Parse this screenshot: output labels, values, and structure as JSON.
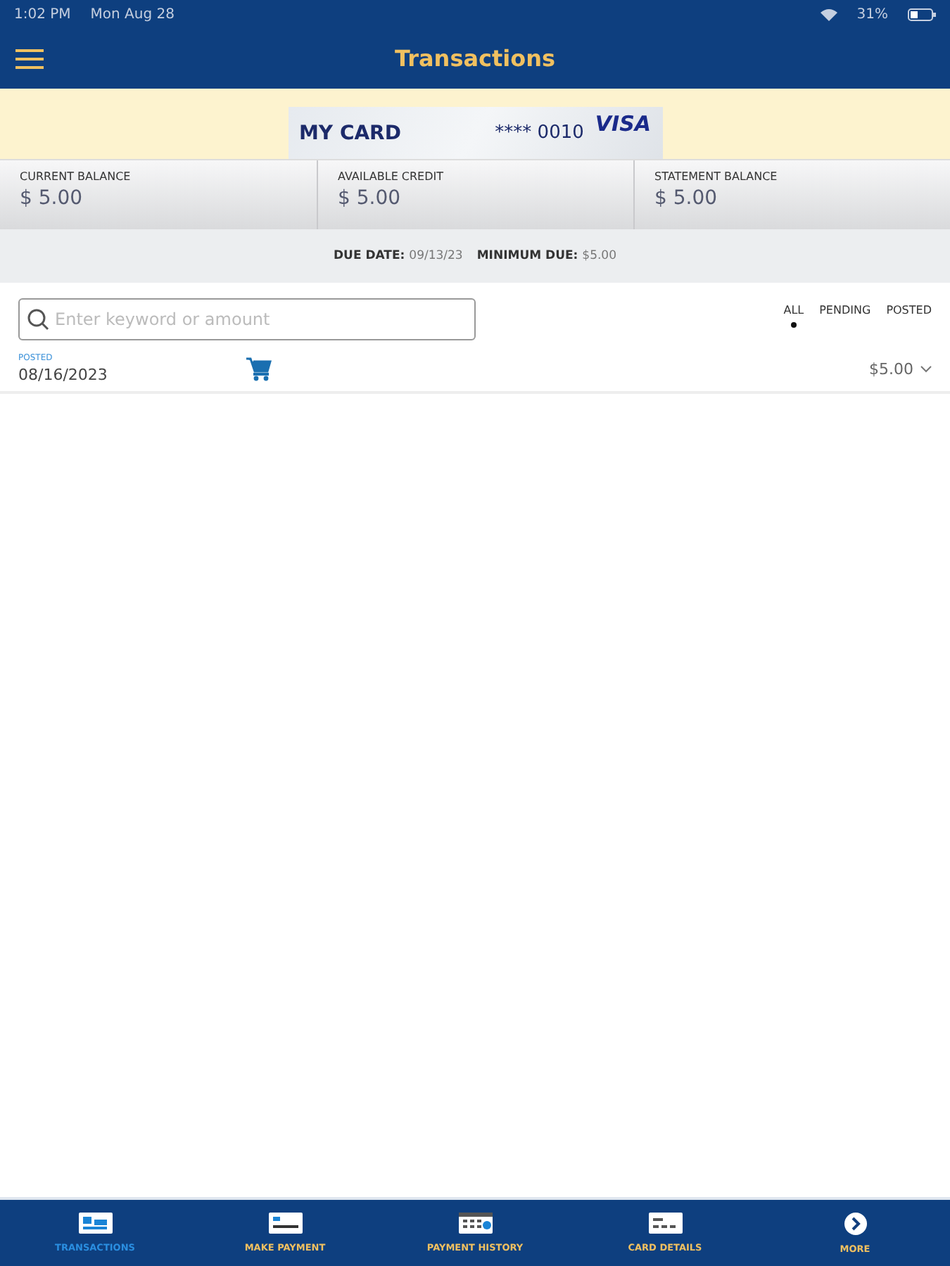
{
  "status_bar": {
    "time": "1:02 PM",
    "date": "Mon Aug 28",
    "battery": "31%"
  },
  "header": {
    "title": "Transactions"
  },
  "card": {
    "name": "MY CARD",
    "number": "**** 0010",
    "brand": "VISA"
  },
  "balances": [
    {
      "label": "CURRENT BALANCE",
      "value": "$ 5.00"
    },
    {
      "label": "AVAILABLE CREDIT",
      "value": "$ 5.00"
    },
    {
      "label": "STATEMENT BALANCE",
      "value": "$ 5.00"
    }
  ],
  "due": {
    "date_label": "DUE DATE:",
    "date": "09/13/23",
    "min_label": "MINIMUM DUE:",
    "min": "$5.00"
  },
  "search": {
    "placeholder": "Enter keyword or amount"
  },
  "filters": [
    {
      "label": "ALL",
      "selected": true
    },
    {
      "label": "PENDING",
      "selected": false
    },
    {
      "label": "POSTED",
      "selected": false
    }
  ],
  "transactions": [
    {
      "status": "POSTED",
      "date": "08/16/2023",
      "amount": "$5.00"
    }
  ],
  "tabs": [
    {
      "label": "TRANSACTIONS",
      "selected": true
    },
    {
      "label": "MAKE PAYMENT",
      "selected": false
    },
    {
      "label": "PAYMENT HISTORY",
      "selected": false
    },
    {
      "label": "CARD DETAILS",
      "selected": false
    },
    {
      "label": "MORE",
      "selected": false
    }
  ]
}
